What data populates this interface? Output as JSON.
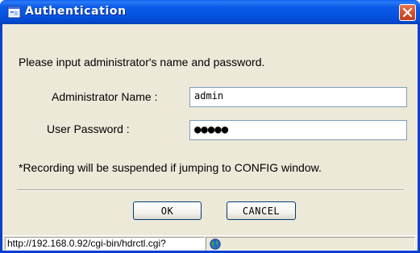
{
  "window": {
    "title": "Authentication",
    "app_icon": "window-app-icon",
    "close_icon": "close-icon",
    "titlebar_color": "#0a5ef7",
    "close_color": "#d8532e"
  },
  "dialog": {
    "prompt": "Please input administrator's name and password.",
    "admin_name_label": "Administrator Name :",
    "admin_name_value": "admin",
    "password_label": "User Password :",
    "password_value": "●●●●●",
    "note": "*Recording will be suspended if jumping to CONFIG window.",
    "ok_label": "OK",
    "cancel_label": "CANCEL"
  },
  "statusbar": {
    "url": "http://192.168.0.92/cgi-bin/hdrctl.cgi?",
    "zone_icon": "globe-icon"
  }
}
